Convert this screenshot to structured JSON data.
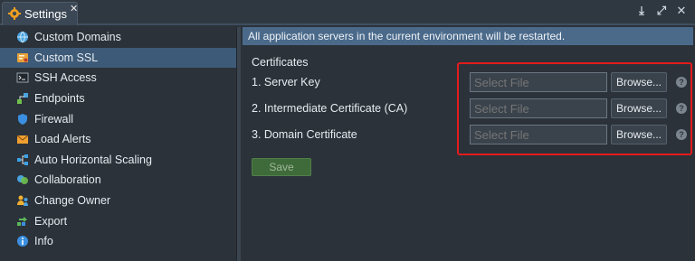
{
  "tab": {
    "title": "Settings",
    "close": "✕",
    "icon": "gear-icon"
  },
  "window_tools": [
    {
      "name": "download-icon",
      "glyph": "⤓"
    },
    {
      "name": "expand-icon",
      "glyph": "⤢"
    },
    {
      "name": "close-window-icon",
      "glyph": "✕"
    }
  ],
  "sidebar": {
    "items": [
      {
        "label": "Custom Domains",
        "icon": "domains-icon",
        "color": "#4aa3df"
      },
      {
        "label": "Custom SSL",
        "icon": "ssl-certificate-icon",
        "color": "#e8a33b",
        "active": true
      },
      {
        "label": "SSH Access",
        "icon": "terminal-icon",
        "color": "#9aa4ad"
      },
      {
        "label": "Endpoints",
        "icon": "endpoints-icon",
        "color": "#6fbf4d"
      },
      {
        "label": "Firewall",
        "icon": "shield-icon",
        "color": "#3b8fe0"
      },
      {
        "label": "Load Alerts",
        "icon": "alert-mail-icon",
        "color": "#f0a030"
      },
      {
        "label": "Auto Horizontal Scaling",
        "icon": "scaling-icon",
        "color": "#3ba3e8"
      },
      {
        "label": "Collaboration",
        "icon": "collaboration-icon",
        "color": "#4aa3df"
      },
      {
        "label": "Change Owner",
        "icon": "change-owner-icon",
        "color": "#f0b030"
      },
      {
        "label": "Export",
        "icon": "export-icon",
        "color": "#5cb85c"
      },
      {
        "label": "Info",
        "icon": "info-icon",
        "color": "#3b8fe0"
      }
    ]
  },
  "main": {
    "notice": "All application servers in the current environment will be restarted.",
    "section_title": "Certificates",
    "rows": [
      {
        "label": "1. Server Key",
        "placeholder": "Select File",
        "browse": "Browse...",
        "help": "?"
      },
      {
        "label": "2. Intermediate Certificate (CA)",
        "placeholder": "Select File",
        "browse": "Browse...",
        "help": "?"
      },
      {
        "label": "3. Domain Certificate",
        "placeholder": "Select File",
        "browse": "Browse...",
        "help": "?"
      }
    ],
    "save_label": "Save"
  },
  "colors": {
    "accent": "#3d5a78",
    "notice_bg": "#4b6a8a",
    "highlight": "#e41b1b",
    "save_bg": "#3f6a3a"
  }
}
